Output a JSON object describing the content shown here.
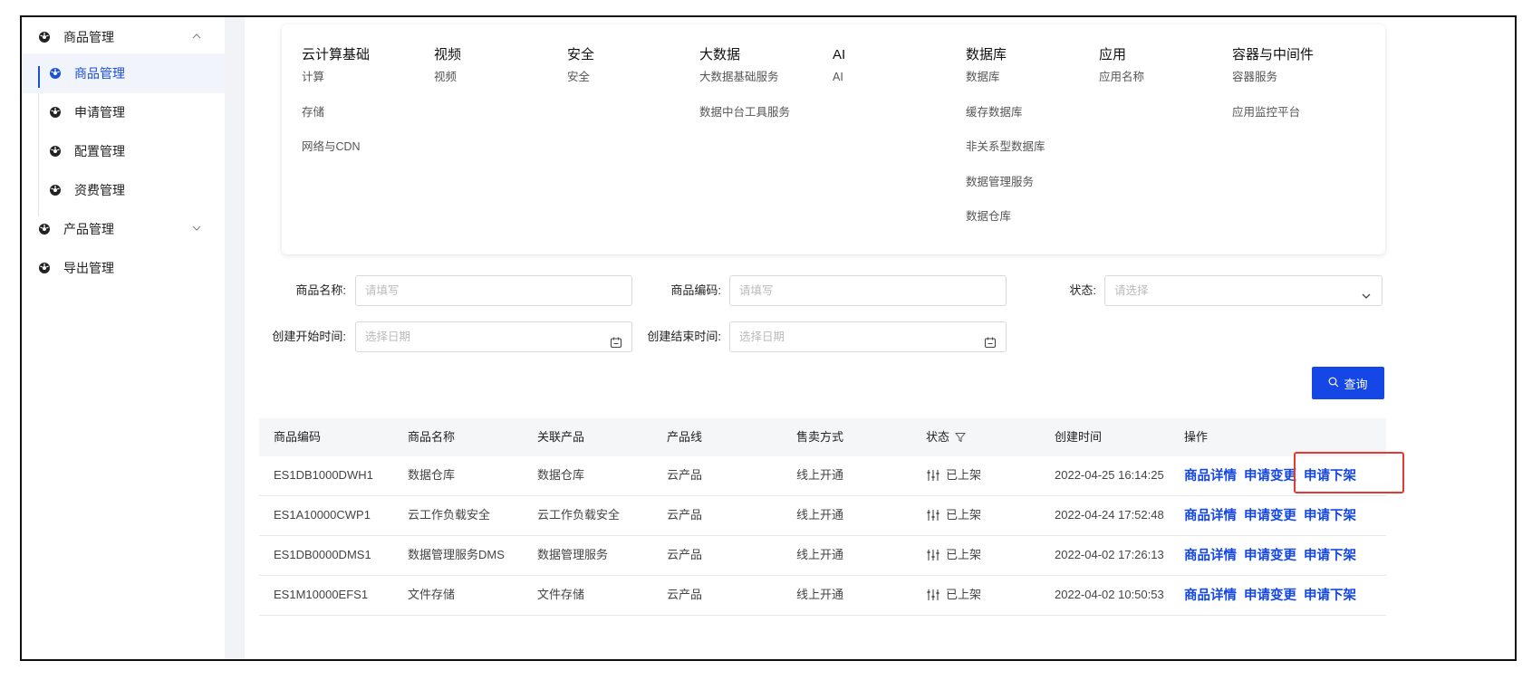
{
  "sidebar": {
    "groups": [
      {
        "label": "商品管理",
        "expanded": true
      },
      {
        "label": "产品管理",
        "expanded": false
      },
      {
        "label": "导出管理"
      }
    ],
    "sub_items": [
      {
        "label": "商品管理",
        "active": true
      },
      {
        "label": "申请管理"
      },
      {
        "label": "配置管理"
      },
      {
        "label": "资费管理"
      }
    ]
  },
  "categories": [
    {
      "title": "云计算基础",
      "items": [
        "计算",
        "存储",
        "网络与CDN"
      ]
    },
    {
      "title": "视频",
      "items": [
        "视频"
      ]
    },
    {
      "title": "安全",
      "items": [
        "安全"
      ]
    },
    {
      "title": "大数据",
      "items": [
        "大数据基础服务",
        "数据中台工具服务"
      ]
    },
    {
      "title": "AI",
      "items": [
        "AI"
      ]
    },
    {
      "title": "数据库",
      "items": [
        "数据库",
        "缓存数据库",
        "非关系型数据库",
        "数据管理服务",
        "数据仓库"
      ]
    },
    {
      "title": "应用",
      "items": [
        "应用名称"
      ]
    },
    {
      "title": "容器与中间件",
      "items": [
        "容器服务",
        "应用监控平台"
      ]
    }
  ],
  "filters": {
    "product_name": {
      "label": "商品名称:",
      "placeholder": "请填写"
    },
    "product_code": {
      "label": "商品编码:",
      "placeholder": "请填写"
    },
    "status": {
      "label": "状态:",
      "placeholder": "请选择"
    },
    "start_time": {
      "label": "创建开始时间:",
      "placeholder": "选择日期"
    },
    "end_time": {
      "label": "创建结束时间:",
      "placeholder": "选择日期"
    }
  },
  "query_button": {
    "label": "查询"
  },
  "table": {
    "columns": [
      "商品编码",
      "商品名称",
      "关联产品",
      "产品线",
      "售卖方式",
      "状态",
      "创建时间",
      "操作"
    ],
    "rows": [
      {
        "code": "ES1DB1000DWH1",
        "name": "数据仓库",
        "product": "数据仓库",
        "line": "云产品",
        "sale": "线上开通",
        "status": "已上架",
        "created": "2022-04-25 16:14:25"
      },
      {
        "code": "ES1A10000CWP1",
        "name": "云工作负载安全",
        "product": "云工作负载安全",
        "line": "云产品",
        "sale": "线上开通",
        "status": "已上架",
        "created": "2022-04-24 17:52:48"
      },
      {
        "code": "ES1DB0000DMS1",
        "name": "数据管理服务DMS",
        "product": "数据管理服务",
        "line": "云产品",
        "sale": "线上开通",
        "status": "已上架",
        "created": "2022-04-02 17:26:13"
      },
      {
        "code": "ES1M10000EFS1",
        "name": "文件存储",
        "product": "文件存储",
        "line": "云产品",
        "sale": "线上开通",
        "status": "已上架",
        "created": "2022-04-02 10:50:53"
      }
    ],
    "actions": [
      "商品详情",
      "申请变更",
      "申请下架"
    ]
  },
  "colors": {
    "accent": "#1447e6",
    "highlight": "#e53935"
  }
}
